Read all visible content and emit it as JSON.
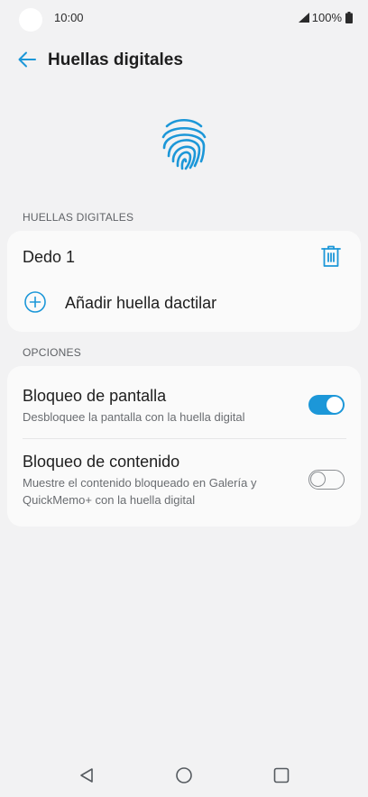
{
  "status_bar": {
    "time": "10:00",
    "battery_text": "100%",
    "icons": [
      "signal-icon",
      "battery-icon"
    ]
  },
  "header": {
    "back_icon": "arrow-left-icon",
    "title": "Huellas digitales"
  },
  "hero": {
    "icon": "fingerprint-icon"
  },
  "fingerprints_section": {
    "header": "HUELLAS DIGITALES",
    "items": [
      {
        "label": "Dedo 1",
        "action_icon": "trash-icon"
      }
    ],
    "add_label": "Añadir huella dactilar",
    "add_icon": "plus-circle-icon"
  },
  "options_section": {
    "header": "OPCIONES",
    "items": [
      {
        "title": "Bloqueo de pantalla",
        "description": "Desbloquee la pantalla con la huella digital",
        "toggle": "on"
      },
      {
        "title": "Bloqueo de contenido",
        "description": "Muestre el contenido bloqueado en Galería y QuickMemo+ con la huella digital",
        "toggle": "off"
      }
    ]
  },
  "nav_bar": {
    "icons": [
      "back-triangle-icon",
      "home-circle-icon",
      "recents-square-icon"
    ]
  },
  "colors": {
    "accent": "#1c97d8",
    "background": "#f2f2f3",
    "card": "#fafafa",
    "text_primary": "#1e1e1e",
    "text_secondary": "#6a6d71"
  }
}
